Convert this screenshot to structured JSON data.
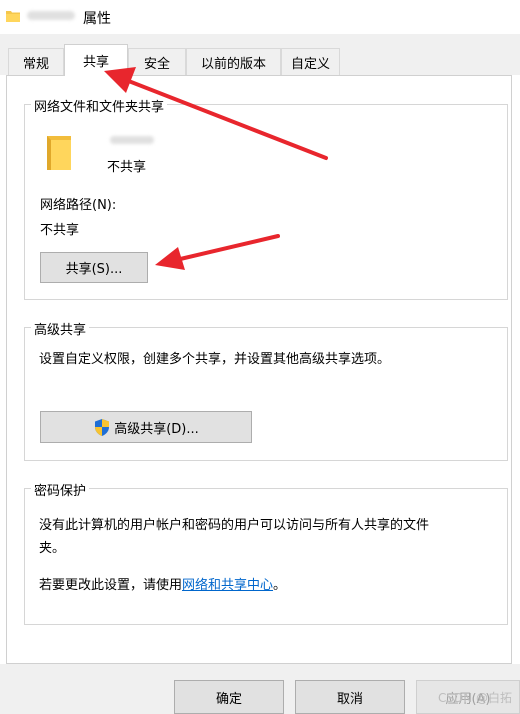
{
  "window": {
    "title": "属性",
    "title_redacted": true
  },
  "tabs": [
    {
      "label": "常规",
      "active": false
    },
    {
      "label": "共享",
      "active": true
    },
    {
      "label": "安全",
      "active": false
    },
    {
      "label": "以前的版本",
      "active": false
    },
    {
      "label": "自定义",
      "active": false
    }
  ],
  "network_sharing": {
    "group_label": "网络文件和文件夹共享",
    "folder_name_redacted": true,
    "share_status": "不共享",
    "path_label": "网络路径(N):",
    "path_value": "不共享",
    "share_button": "共享(S)..."
  },
  "advanced_sharing": {
    "group_label": "高级共享",
    "description": "设置自定义权限，创建多个共享，并设置其他高级共享选项。",
    "button": "高级共享(D)...",
    "button_icon": "uac-shield-icon"
  },
  "password_protection": {
    "group_label": "密码保护",
    "description_line1": "没有此计算机的用户帐户和密码的用户可以访问与所有人共享的文件",
    "description_line2": "夹。",
    "change_prefix": "若要更改此设置，请使用",
    "change_link": "网络和共享中心",
    "change_suffix": "。"
  },
  "buttons": {
    "ok": "确定",
    "cancel": "取消",
    "apply": "应用(A)"
  },
  "watermark": "CSDN @白拓",
  "colors": {
    "annotation_arrow": "#e8262d",
    "link": "#0066cc",
    "folder": "#f5c74c"
  }
}
